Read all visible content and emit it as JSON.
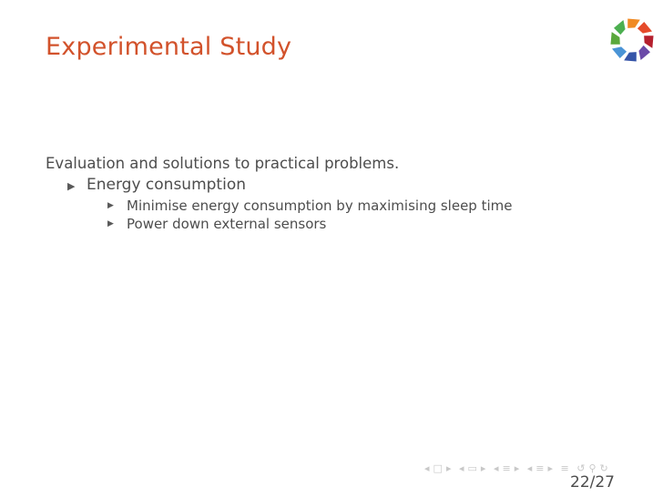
{
  "slide": {
    "title": "Experimental Study",
    "lead": "Evaluation and solutions to practical problems.",
    "items": [
      {
        "label": "Energy consumption",
        "subitems": [
          "Minimise energy consumption by maximising sleep time",
          "Power down external sensors"
        ]
      }
    ]
  },
  "logo": {
    "name": "colorful-ring-logo",
    "colors": [
      "#f08a24",
      "#e54b2b",
      "#b5202e",
      "#6b4aa8",
      "#3554a8",
      "#4a94d6",
      "#5aa83c",
      "#4caf50"
    ]
  },
  "navigation": {
    "icons": [
      "nav-frame-prev",
      "nav-frame",
      "nav-frame-next",
      "nav-subsection-prev",
      "nav-subsection",
      "nav-subsection-next",
      "nav-section-prev",
      "nav-section",
      "nav-section-next",
      "nav-toc",
      "undo",
      "search",
      "redo"
    ],
    "glyphs": {
      "prev": "◂",
      "next": "▸",
      "frame": "□",
      "subsection": "▭",
      "section": "≡",
      "toc": "≡",
      "undo": "↺",
      "search": "⚲",
      "redo": "↻"
    }
  },
  "footer": {
    "page": "22/27"
  },
  "bullet": "▶"
}
